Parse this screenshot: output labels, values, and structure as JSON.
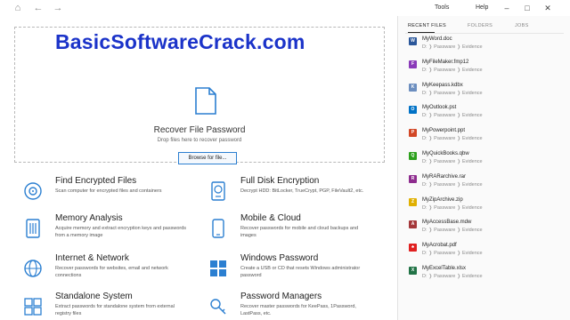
{
  "watermark": "BasicSoftwareCrack.com",
  "menu": {
    "tools": "Tools",
    "help": "Help"
  },
  "drop": {
    "title": "Recover File Password",
    "subtitle": "Drop files here to recover password",
    "browse_label": "Browse for file..."
  },
  "features": [
    {
      "title": "Find Encrypted Files",
      "desc": "Scan computer for encrypted files and containers",
      "icon": "disc-search-icon"
    },
    {
      "title": "Full Disk Encryption",
      "desc": "Decrypt HDD: BitLocker, TrueCrypt, PGP, FileVault2, etc.",
      "icon": "hard-drive-icon"
    },
    {
      "title": "Memory Analysis",
      "desc": "Acquire memory and extract encryption keys and passwords from a memory image",
      "icon": "memory-chip-icon"
    },
    {
      "title": "Mobile & Cloud",
      "desc": "Recover passwords for mobile and cloud backups and images",
      "icon": "mobile-phone-icon"
    },
    {
      "title": "Internet & Network",
      "desc": "Recover passwords for websites, email and network connections",
      "icon": "globe-icon"
    },
    {
      "title": "Windows Password",
      "desc": "Create a USB or CD that resets Windows administrator password",
      "icon": "windows-logo-icon"
    },
    {
      "title": "Standalone System",
      "desc": "Extract passwords for standalone system from external registry files",
      "icon": "registry-grid-icon"
    },
    {
      "title": "Password Managers",
      "desc": "Recover master passwords for KeePass, 1Password, LastPass, etc.",
      "icon": "key-icon"
    }
  ],
  "panel": {
    "tabs": [
      "RECENT FILES",
      "FOLDERS",
      "JOBS"
    ],
    "path": "D: ❭ Passware ❭ Evidence",
    "recent_files": [
      {
        "name": "MyWord.doc",
        "icon": "word-file-icon",
        "color": "#2b579a",
        "glyph": "W"
      },
      {
        "name": "MyFileMaker.fmp12",
        "icon": "filemaker-file-icon",
        "color": "#8a3ab9",
        "glyph": "F"
      },
      {
        "name": "MyKeepass.kdbx",
        "icon": "keepass-lock-icon",
        "color": "#6c8ebf",
        "glyph": "K"
      },
      {
        "name": "MyOutlook.pst",
        "icon": "outlook-file-icon",
        "color": "#0072c6",
        "glyph": "O"
      },
      {
        "name": "MyPowerpoint.ppt",
        "icon": "powerpoint-file-icon",
        "color": "#d24726",
        "glyph": "P"
      },
      {
        "name": "MyQuickBooks.qbw",
        "icon": "quickbooks-file-icon",
        "color": "#2ca01c",
        "glyph": "Q"
      },
      {
        "name": "MyRARarchive.rar",
        "icon": "rar-archive-icon",
        "color": "#8e2c8e",
        "glyph": "R"
      },
      {
        "name": "MyZipArchive.zip",
        "icon": "zip-archive-icon",
        "color": "#e0b000",
        "glyph": "Z"
      },
      {
        "name": "MyAccessBase.mdw",
        "icon": "access-file-icon",
        "color": "#a4373a",
        "glyph": "A"
      },
      {
        "name": "MyAcrobat.pdf",
        "icon": "pdf-file-icon",
        "color": "#e02020",
        "glyph": "♣"
      },
      {
        "name": "MyExcelTable.xlsx",
        "icon": "excel-file-icon",
        "color": "#217346",
        "glyph": "X"
      }
    ]
  }
}
